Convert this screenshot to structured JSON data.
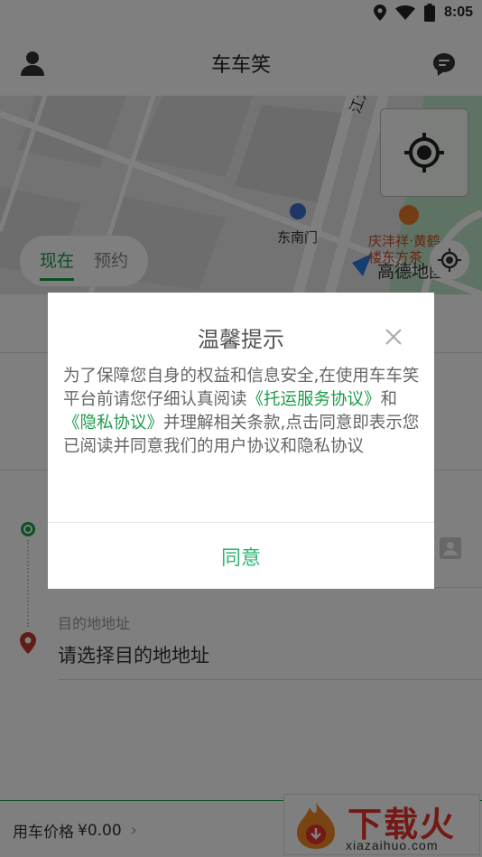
{
  "status": {
    "time": "8:05"
  },
  "header": {
    "title": "车车笑"
  },
  "map": {
    "poi_gate": "东南门",
    "poi_shop_line1": "庆沣祥·黄鹤",
    "poi_shop_line2": "楼东方茶",
    "road_name": "江大道",
    "logo_text": "高德地图"
  },
  "tabs": [
    {
      "label": "现在",
      "active": true
    },
    {
      "label": "预约",
      "active": false
    }
  ],
  "form": {
    "destination_label": "目的地地址",
    "destination_placeholder": "请选择目的地地址"
  },
  "footer": {
    "price_label": "用车价格",
    "price_value": "¥0.00"
  },
  "watermark": {
    "brand": "下载火",
    "url": "xiazaihuo.com"
  },
  "dialog": {
    "title": "温馨提示",
    "body_part1": "为了保障您自身的权益和信息安全,在使用车车笑平台前请您仔细认真阅读",
    "link_transport": "《托运服务协议》",
    "body_part2": "和",
    "link_privacy": "《隐私协议》",
    "body_part3": "并理解相关条款,点击同意即表示您已阅读并同意我们的用户协议和隐私协议",
    "agree_label": "同意"
  },
  "colors": {
    "accent": "#1a9d4a",
    "agree": "#2bb673",
    "watermark": "#e8322a"
  }
}
